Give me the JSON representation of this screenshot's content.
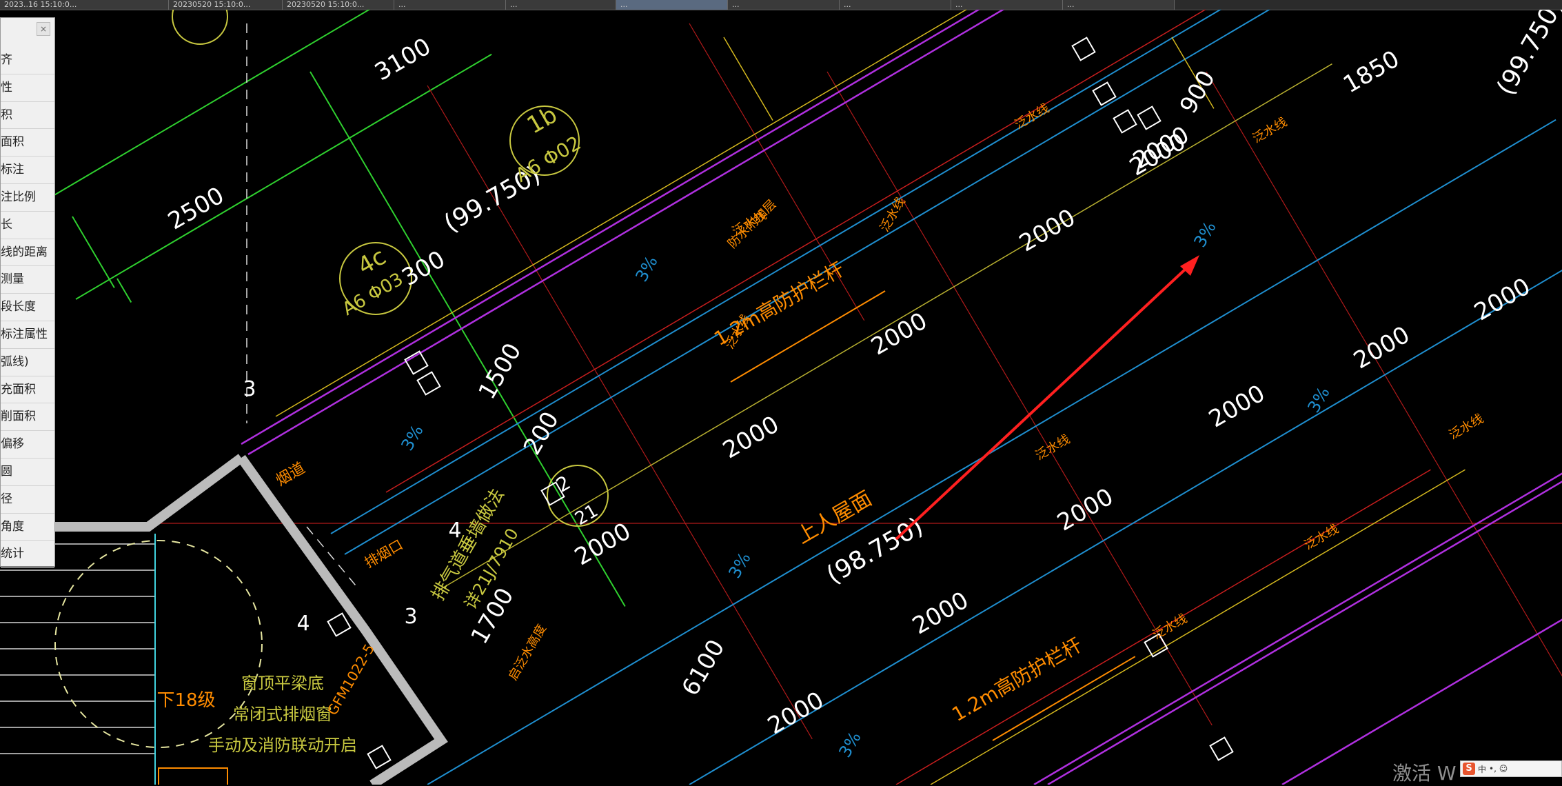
{
  "tabs": [
    {
      "label": "2023..16 15:10:0...",
      "active": false
    },
    {
      "label": "20230520 15:10:0...",
      "active": false
    },
    {
      "label": "20230520 15:10:0...",
      "active": false
    },
    {
      "label": "...",
      "active": false
    },
    {
      "label": "...",
      "active": false
    },
    {
      "label": "...",
      "active": true
    },
    {
      "label": "...",
      "active": false
    },
    {
      "label": "...",
      "active": false
    },
    {
      "label": "...",
      "active": false
    },
    {
      "label": "...",
      "active": false
    }
  ],
  "panel": {
    "close": "×",
    "items": [
      "齐",
      "性",
      "积",
      "面积",
      "标注",
      "注比例",
      "长",
      "线的距离",
      "测量",
      "段长度",
      "标注属性",
      "弧线)",
      "充面积",
      "削面积",
      "偏移",
      "圆",
      "径",
      "角度",
      "统计"
    ]
  },
  "drawing": {
    "dims_white": [
      "3100",
      "2500",
      "300",
      "1500",
      "200",
      "2000",
      "2000",
      "2000",
      "2000",
      "2000",
      "2000",
      "2000",
      "2000",
      "2000",
      "2000",
      "2000",
      "1700",
      "6100",
      "1850",
      "900",
      "2000"
    ],
    "elevations": [
      "(99.750)",
      "(98.750)",
      "(99.750)"
    ],
    "roof_label": "上人屋面",
    "bubbles": [
      {
        "top": "1b",
        "bottom": "A6 Φ02"
      },
      {
        "top": "4c",
        "bottom": "A6 Φ03"
      },
      {
        "top": "2",
        "bottom": "21"
      }
    ],
    "slope": "3%",
    "railing_label": "1.2m高防护栏杆",
    "flue": "烟道",
    "exhaust": "排烟口",
    "pipe_note": "排气道垂墙做法",
    "ref": "详21J/7910",
    "stair": "下18级",
    "window_notes": [
      "窗顶平梁底",
      "常闭式排烟窗",
      "手动及消防联动开启"
    ],
    "door_tag": "GFM1022-5",
    "small_marks": [
      "3",
      "4",
      "3",
      "4"
    ],
    "misc": [
      "泛水线",
      "防水附加层",
      "启泛水高度"
    ],
    "numbered": "3"
  },
  "watermark": "激活 W",
  "ime": {
    "logo": "S",
    "text": "中",
    "extra": "•, ☺"
  }
}
